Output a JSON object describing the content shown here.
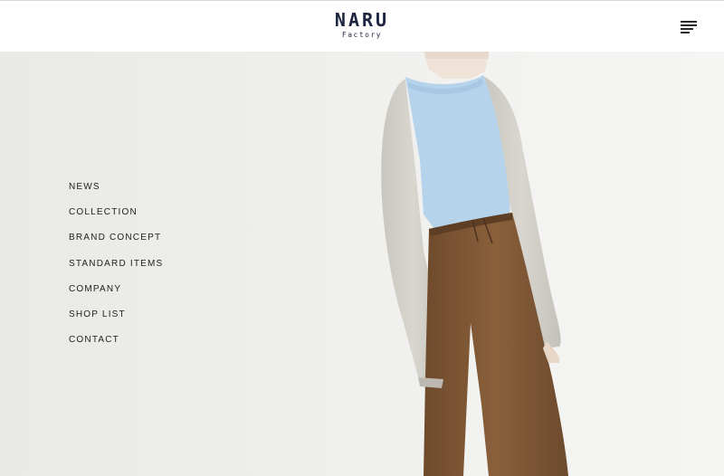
{
  "header": {
    "logo_main": "NARU",
    "logo_sub": "Factory",
    "menu_icon": "hamburger-menu-icon"
  },
  "nav": {
    "items": [
      {
        "label": "NEWS"
      },
      {
        "label": "COLLECTION"
      },
      {
        "label": "BRAND CONCEPT"
      },
      {
        "label": "STANDARD ITEMS"
      },
      {
        "label": "COMPANY"
      },
      {
        "label": "SHOP LIST"
      },
      {
        "label": "CONTACT"
      }
    ]
  },
  "colors": {
    "logo": "#1c2440",
    "nav_text": "#222222",
    "header_bg": "#ffffff",
    "hero_bg": "#ececea"
  }
}
